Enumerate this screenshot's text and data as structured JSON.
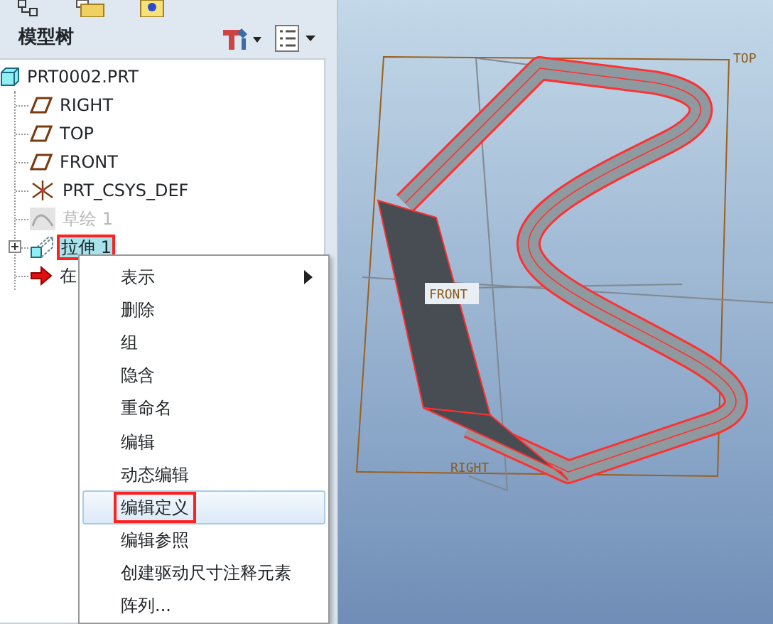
{
  "panel": {
    "title": "模型树"
  },
  "tree": {
    "label": "PRT0002.PRT",
    "kind": "part",
    "children": [
      {
        "label": "RIGHT",
        "kind": "plane",
        "selected": false,
        "dimmed": false,
        "annotated": false,
        "expandable": false
      },
      {
        "label": "TOP",
        "kind": "plane",
        "selected": false,
        "dimmed": false,
        "annotated": false,
        "expandable": false
      },
      {
        "label": "FRONT",
        "kind": "plane",
        "selected": false,
        "dimmed": false,
        "annotated": false,
        "expandable": false
      },
      {
        "label": "PRT_CSYS_DEF",
        "kind": "csys",
        "selected": false,
        "dimmed": false,
        "annotated": false,
        "expandable": false
      },
      {
        "label": "草绘 1",
        "kind": "sketch",
        "selected": false,
        "dimmed": true,
        "annotated": false,
        "expandable": false
      },
      {
        "label": "拉伸 1",
        "kind": "extrude",
        "selected": true,
        "dimmed": false,
        "annotated": true,
        "expandable": true
      },
      {
        "label": "在",
        "kind": "insert",
        "selected": false,
        "dimmed": false,
        "annotated": false,
        "expandable": false
      }
    ]
  },
  "context_menu": [
    {
      "label": "表示",
      "submenu": true,
      "selected": false,
      "annotated": false
    },
    {
      "label": "删除",
      "submenu": false,
      "selected": false,
      "annotated": false
    },
    {
      "label": "组",
      "submenu": false,
      "selected": false,
      "annotated": false
    },
    {
      "label": "隐含",
      "submenu": false,
      "selected": false,
      "annotated": false
    },
    {
      "label": "重命名",
      "submenu": false,
      "selected": false,
      "annotated": false
    },
    {
      "label": "编辑",
      "submenu": false,
      "selected": false,
      "annotated": false
    },
    {
      "label": "动态编辑",
      "submenu": false,
      "selected": false,
      "annotated": false
    },
    {
      "label": "编辑定义",
      "submenu": false,
      "selected": true,
      "annotated": true
    },
    {
      "label": "编辑参照",
      "submenu": false,
      "selected": false,
      "annotated": false
    },
    {
      "label": "创建驱动尺寸注释元素",
      "submenu": false,
      "selected": false,
      "annotated": false
    },
    {
      "label": "阵列...",
      "submenu": false,
      "selected": false,
      "annotated": false
    }
  ],
  "viewport": {
    "datum_labels": [
      {
        "kind": "top",
        "label": "TOP"
      },
      {
        "kind": "front",
        "label": "FRONT"
      },
      {
        "kind": "right",
        "label": "RIGHT"
      }
    ]
  }
}
